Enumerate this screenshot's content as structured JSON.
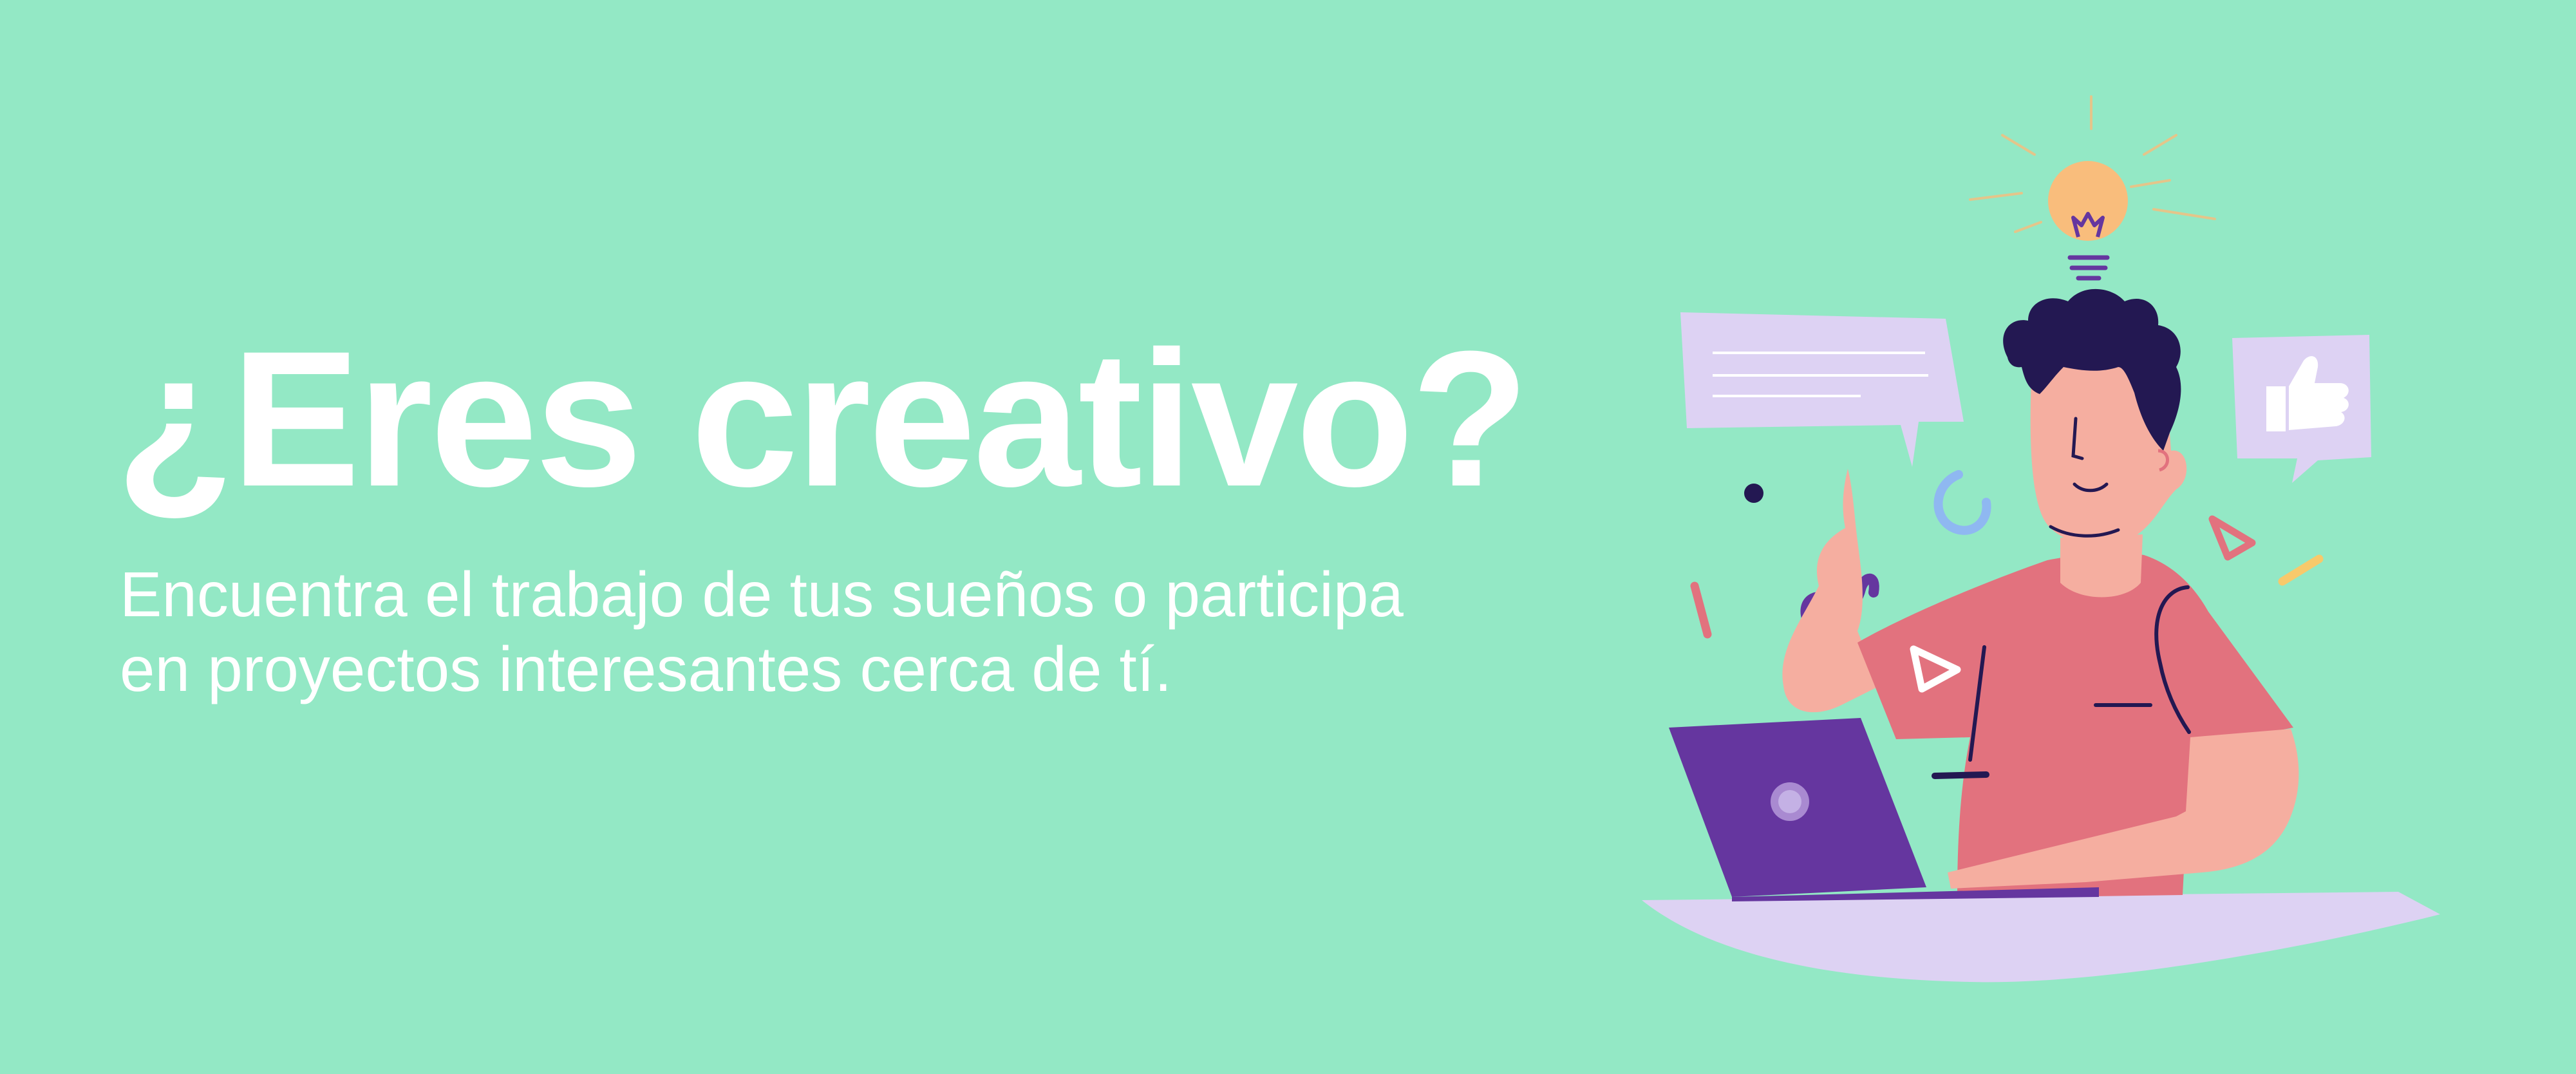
{
  "banner": {
    "headline": "¿Eres creativo?",
    "subtitle_line1": "Encuentra el trabajo de tus sueños o participa",
    "subtitle_line2": "en proyectos interesantes cerca de tí."
  },
  "colors": {
    "background": "#93e8c5",
    "text": "#ffffff",
    "shirt": "#e2727e",
    "skin": "#f5aea0",
    "hair": "#231852",
    "laptop": "#65369f",
    "desk": "#ddd2f3",
    "bulb": "#f9bd7c",
    "bubble": "#ddd2f3"
  },
  "illustration": {
    "icons": [
      "lightbulb-icon",
      "speech-bubble-icon",
      "thumbs-up-icon",
      "play-icon",
      "laptop-icon"
    ]
  }
}
